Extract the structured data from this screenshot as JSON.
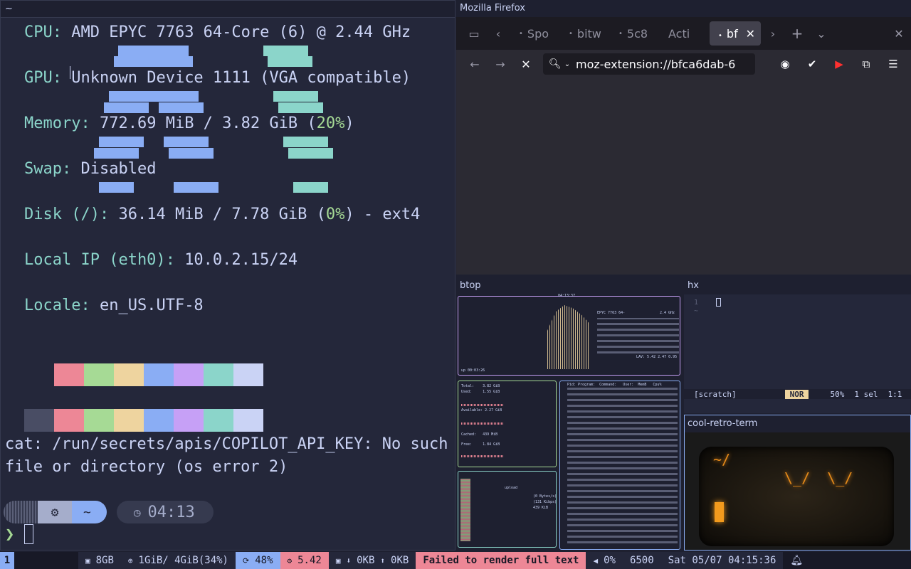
{
  "terminal": {
    "title": "~",
    "fastfetch": {
      "cpu_key": "CPU",
      "cpu_val": "AMD EPYC 7763 64-Core (6) @ 2.44 GHz",
      "gpu_key": "GPU",
      "gpu_val": "Unknown Device 1111 (VGA compatible)",
      "mem_key": "Memory",
      "mem_val": "772.69 MiB / 3.82 GiB (",
      "mem_pct": "20%",
      "mem_close": ")",
      "swap_key": "Swap",
      "swap_val": "Disabled",
      "disk_key": "Disk (/)",
      "disk_val": "36.14 MiB / 7.78 GiB (",
      "disk_pct": "0%",
      "disk_close": ") - ext4",
      "ip_key": "Local IP (eth0)",
      "ip_val": "10.0.2.15/24",
      "locale_key": "Locale",
      "locale_val": "en_US.UTF-8",
      "colon": ": "
    },
    "palette_top": [
      "#ed8796",
      "#a6da95",
      "#eed49f",
      "#8aadf4",
      "#c6a0f6",
      "#8bd5ca",
      "#cad3f5"
    ],
    "palette_bottom": [
      "#494d64",
      "#ed8796",
      "#a6da95",
      "#eed49f",
      "#8aadf4",
      "#c6a0f6",
      "#8bd5ca",
      "#cad3f5"
    ],
    "error": "cat: /run/secrets/apis/COPILOT_API_KEY: No such file or directory (os error 2)",
    "prompt": {
      "dir": "~",
      "time": "04:13",
      "symbol": "❯"
    }
  },
  "firefox": {
    "title": "Mozilla Firefox",
    "tabs": [
      {
        "label": "Spo"
      },
      {
        "label": "bitw"
      },
      {
        "label": "5c8"
      },
      {
        "label": "Acti"
      },
      {
        "label": "bf"
      }
    ],
    "url": "moz-extension://bfca6dab-6"
  },
  "btop": {
    "title": "btop",
    "uptime": "up 00:03:26",
    "clock": "04:13:37",
    "cpu_name": "EPYC 7763 64-",
    "cpu_freq": "2.4 GHz",
    "load": "LAV: 5.42 2.47 0.95",
    "mem_total": "Total:    3.82 GiB",
    "mem_used": "Used:     1.55 GiB",
    "mem_avail": "Available: 2.27 GiB",
    "mem_cached": "Cached:   439 MiB",
    "mem_free": "Free:     1.84 GiB",
    "net_upload": "upload",
    "net_down": "(0 Bytes/s)",
    "net_top": "(131 Kibps)",
    "net_total": "439 KiB",
    "proc_header": "Pid: Program:  Command:   User:  MemB   Cpu%"
  },
  "hx": {
    "title": "hx",
    "line_no": "1",
    "tilde": "~",
    "buffer": "[scratch]",
    "mode": "NOR",
    "pct": "50%",
    "sel": "1 sel",
    "pos": "1:1"
  },
  "crt": {
    "title": "cool-retro-term",
    "prompt": "~/",
    "face": "\\_/  \\_/"
  },
  "bar": {
    "workspace": "1",
    "ram": "8GB",
    "mem": "1GiB/ 4GiB(34%)",
    "cpu": "48%",
    "load": "5.42",
    "net_down": "0KB",
    "net_up": "0KB",
    "error": "Failed to render full text",
    "volume": "0%",
    "temp": "6500",
    "clock": "Sat 05/07 04:15:36"
  }
}
